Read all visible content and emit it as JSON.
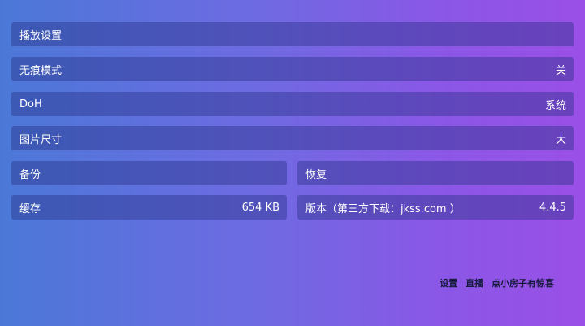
{
  "settings": {
    "playback": {
      "label": "播放设置"
    },
    "incognito": {
      "label": "无痕模式",
      "value": "关"
    },
    "doh": {
      "label": "DoH",
      "value": "系统"
    },
    "image_size": {
      "label": "图片尺寸",
      "value": "大"
    },
    "backup": {
      "label": "备份"
    },
    "restore": {
      "label": "恢复"
    },
    "cache": {
      "label": "缓存",
      "value": "654 KB"
    },
    "version": {
      "label": "版本（第三方下载：jkss.com ）",
      "value": "4.4.5"
    }
  },
  "footer": {
    "settings": "设置",
    "live": "直播",
    "house": "点小房子有惊喜"
  }
}
